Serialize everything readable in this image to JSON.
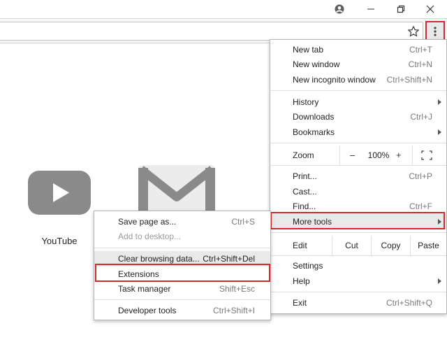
{
  "new_tab_page": {
    "tiles": [
      {
        "label": "YouTube",
        "icon": "youtube-icon"
      },
      {
        "label": "",
        "icon": "gmail-icon"
      }
    ]
  },
  "main_menu": {
    "new_tab": {
      "label": "New tab",
      "shortcut": "Ctrl+T"
    },
    "new_window": {
      "label": "New window",
      "shortcut": "Ctrl+N"
    },
    "new_incognito": {
      "label": "New incognito window",
      "shortcut": "Ctrl+Shift+N"
    },
    "history": {
      "label": "History"
    },
    "downloads": {
      "label": "Downloads",
      "shortcut": "Ctrl+J"
    },
    "bookmarks": {
      "label": "Bookmarks"
    },
    "zoom": {
      "label": "Zoom",
      "minus": "–",
      "value": "100%",
      "plus": "+"
    },
    "print": {
      "label": "Print...",
      "shortcut": "Ctrl+P"
    },
    "cast": {
      "label": "Cast..."
    },
    "find": {
      "label": "Find...",
      "shortcut": "Ctrl+F"
    },
    "more_tools": {
      "label": "More tools"
    },
    "edit": {
      "label": "Edit",
      "cut": "Cut",
      "copy": "Copy",
      "paste": "Paste"
    },
    "settings": {
      "label": "Settings"
    },
    "help": {
      "label": "Help"
    },
    "exit": {
      "label": "Exit",
      "shortcut": "Ctrl+Shift+Q"
    }
  },
  "more_tools_menu": {
    "save_page": {
      "label": "Save page as...",
      "shortcut": "Ctrl+S"
    },
    "add_desktop": {
      "label": "Add to desktop..."
    },
    "clear_browsing": {
      "label": "Clear browsing data...",
      "shortcut": "Ctrl+Shift+Del"
    },
    "extensions": {
      "label": "Extensions"
    },
    "task_manager": {
      "label": "Task manager",
      "shortcut": "Shift+Esc"
    },
    "developer_tools": {
      "label": "Developer tools",
      "shortcut": "Ctrl+Shift+I"
    }
  },
  "colors": {
    "highlight_outline": "#d12a2a",
    "hover_background": "#e9e9e9",
    "tile_gray": "#8a8a8a"
  }
}
